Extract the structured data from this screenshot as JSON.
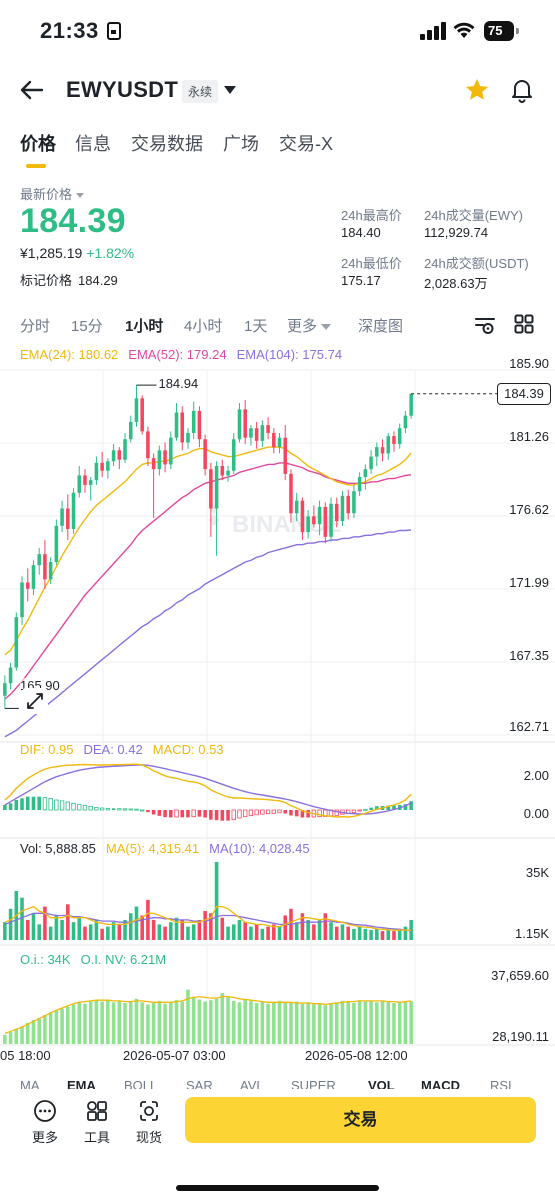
{
  "status": {
    "time": "21:33",
    "battery": "75"
  },
  "header": {
    "symbol": "EWYUSDT",
    "contract_tag": "永续"
  },
  "tabs": [
    "价格",
    "信息",
    "交易数据",
    "广场",
    "交易-X"
  ],
  "price": {
    "latest_label": "最新价格",
    "last": "184.39",
    "cny": "¥1,285.19",
    "change": "+1.82%",
    "mark_label": "标记价格",
    "mark": "184.29"
  },
  "stats": {
    "high_label": "24h最高价",
    "high": "184.40",
    "low_label": "24h最低价",
    "low": "175.17",
    "vol_label": "24h成交量(EWY)",
    "vol": "112,929.74",
    "turnover_label": "24h成交额(USDT)",
    "turnover": "2,028.63万"
  },
  "intervals": {
    "items": [
      "分时",
      "15分",
      "1小时",
      "4小时",
      "1天",
      "更多",
      "深度图"
    ],
    "active": "1小时"
  },
  "legends": {
    "ema24": "EMA(24): 180.62",
    "ema52": "EMA(52): 179.24",
    "ema104": "EMA(104): 175.74",
    "dif": "DIF: 0.95",
    "dea": "DEA: 0.42",
    "macd": "MACD: 0.53",
    "vol": "Vol: 5,888.85",
    "ma5": "MA(5): 4,315.41",
    "ma10": "MA(10): 4,028.45",
    "oi": "O.i.: 34K",
    "oinv": "O.I. NV: 6.21M"
  },
  "axes": {
    "price_ticks": [
      "185.90",
      "181.26",
      "176.62",
      "171.99",
      "167.35",
      "162.71"
    ],
    "current_price_tag": "184.39",
    "high_marker": "184.94",
    "low_marker": "165.90",
    "macd_ticks": [
      "2.00",
      "0.00"
    ],
    "vol_ticks": [
      "35K",
      "1.15K"
    ],
    "oi_ticks": [
      "37,659.60",
      "28,190.11"
    ],
    "time_labels": [
      "05 18:00",
      "2026-05-07 03:00",
      "2026-05-08 12:00"
    ]
  },
  "indicator_tabs": [
    "MA",
    "EMA",
    "BOLL",
    "SAR",
    "AVL",
    "SUPER",
    "VOL",
    "MACD",
    "RSI"
  ],
  "watermark": "BINANCE",
  "bottom": {
    "tools": [
      "更多",
      "工具",
      "现货"
    ],
    "trade_label": "交易"
  },
  "colors": {
    "up": "#2ebd85",
    "down": "#f6465d",
    "accent": "#fcd535",
    "ema24": "#f0b90b",
    "ema52": "#e0479e",
    "ema104": "#8a6fe0"
  },
  "chart_data": {
    "type": "candlestick",
    "interval": "1h",
    "ylim": [
      162.71,
      185.9
    ],
    "candles": [
      [
        165.2,
        166.5,
        164.4,
        166.0
      ],
      [
        166.0,
        167.3,
        165.6,
        167.0
      ],
      [
        167.0,
        170.5,
        166.8,
        170.2
      ],
      [
        170.2,
        172.8,
        169.7,
        172.4
      ],
      [
        172.4,
        173.3,
        171.2,
        172.0
      ],
      [
        172.0,
        173.8,
        171.6,
        173.5
      ],
      [
        173.5,
        174.6,
        172.9,
        174.2
      ],
      [
        174.2,
        175.1,
        172.0,
        172.6
      ],
      [
        172.6,
        174.0,
        172.3,
        173.7
      ],
      [
        173.7,
        176.4,
        173.5,
        176.0
      ],
      [
        176.0,
        177.6,
        175.6,
        177.1
      ],
      [
        177.1,
        178.0,
        175.1,
        175.8
      ],
      [
        175.8,
        178.4,
        175.5,
        178.1
      ],
      [
        178.1,
        179.8,
        177.8,
        179.2
      ],
      [
        179.2,
        179.6,
        178.1,
        178.6
      ],
      [
        178.6,
        179.1,
        177.6,
        178.9
      ],
      [
        178.9,
        180.4,
        178.6,
        180.0
      ],
      [
        180.0,
        180.7,
        179.1,
        179.5
      ],
      [
        179.5,
        180.3,
        179.0,
        180.1
      ],
      [
        180.1,
        181.2,
        179.8,
        180.8
      ],
      [
        180.8,
        181.0,
        179.6,
        180.2
      ],
      [
        180.2,
        181.9,
        180.0,
        181.5
      ],
      [
        181.5,
        183.0,
        181.3,
        182.6
      ],
      [
        182.6,
        184.94,
        182.3,
        184.1
      ],
      [
        184.1,
        184.3,
        181.8,
        182.0
      ],
      [
        182.0,
        182.3,
        179.8,
        180.3
      ],
      [
        180.3,
        180.6,
        176.5,
        179.6
      ],
      [
        179.6,
        181.1,
        179.2,
        180.8
      ],
      [
        180.8,
        181.3,
        179.4,
        179.9
      ],
      [
        179.9,
        182.0,
        179.6,
        181.6
      ],
      [
        181.6,
        183.8,
        181.4,
        183.2
      ],
      [
        183.2,
        183.6,
        180.8,
        181.3
      ],
      [
        181.3,
        182.2,
        180.9,
        181.9
      ],
      [
        181.9,
        183.9,
        181.5,
        183.3
      ],
      [
        183.3,
        183.6,
        181.0,
        181.5
      ],
      [
        181.5,
        181.8,
        179.2,
        179.6
      ],
      [
        179.6,
        180.0,
        175.3,
        177.1
      ],
      [
        177.1,
        180.1,
        174.1,
        179.8
      ],
      [
        179.8,
        180.2,
        178.9,
        179.2
      ],
      [
        179.2,
        179.8,
        178.8,
        179.5
      ],
      [
        179.5,
        181.9,
        179.3,
        181.5
      ],
      [
        181.5,
        183.8,
        181.3,
        183.4
      ],
      [
        183.4,
        184.0,
        181.2,
        181.6
      ],
      [
        181.6,
        182.4,
        181.1,
        182.2
      ],
      [
        182.2,
        182.6,
        180.9,
        181.4
      ],
      [
        181.4,
        182.7,
        181.0,
        182.4
      ],
      [
        182.4,
        182.9,
        181.5,
        181.9
      ],
      [
        181.9,
        182.2,
        180.6,
        181.0
      ],
      [
        181.0,
        181.9,
        180.6,
        181.6
      ],
      [
        181.6,
        182.4,
        178.9,
        179.3
      ],
      [
        179.3,
        179.6,
        176.2,
        176.8
      ],
      [
        176.8,
        178.1,
        176.3,
        177.6
      ],
      [
        177.6,
        177.8,
        175.1,
        175.6
      ],
      [
        175.6,
        177.0,
        175.2,
        176.6
      ],
      [
        176.6,
        177.3,
        175.9,
        176.1
      ],
      [
        176.1,
        177.6,
        175.4,
        177.2
      ],
      [
        177.2,
        177.5,
        174.9,
        175.3
      ],
      [
        175.3,
        177.8,
        175.0,
        177.4
      ],
      [
        177.4,
        177.8,
        175.9,
        176.3
      ],
      [
        176.3,
        178.2,
        176.0,
        177.9
      ],
      [
        177.9,
        178.3,
        176.4,
        176.8
      ],
      [
        176.8,
        178.6,
        176.5,
        178.2
      ],
      [
        178.2,
        179.4,
        177.9,
        179.1
      ],
      [
        179.1,
        179.9,
        178.3,
        179.6
      ],
      [
        179.6,
        180.8,
        179.3,
        180.4
      ],
      [
        180.4,
        181.3,
        179.8,
        181.0
      ],
      [
        181.0,
        181.5,
        180.1,
        180.6
      ],
      [
        180.6,
        181.9,
        180.2,
        181.7
      ],
      [
        181.7,
        182.0,
        180.7,
        181.2
      ],
      [
        181.2,
        182.5,
        180.9,
        182.2
      ],
      [
        182.2,
        183.3,
        181.9,
        183.0
      ],
      [
        183.0,
        184.4,
        182.8,
        184.39
      ]
    ],
    "ema24": [
      167.8,
      168.1,
      168.7,
      169.4,
      170.0,
      170.7,
      171.4,
      172.1,
      172.7,
      173.4,
      174.1,
      174.7,
      175.3,
      175.9,
      176.4,
      176.9,
      177.3,
      177.6,
      177.9,
      178.2,
      178.5,
      178.8,
      179.2,
      179.6,
      179.9,
      180.0,
      180.0,
      180.1,
      180.1,
      180.2,
      180.4,
      180.5,
      180.6,
      180.8,
      180.9,
      180.9,
      180.7,
      180.6,
      180.5,
      180.4,
      180.4,
      180.5,
      180.6,
      180.7,
      180.8,
      180.9,
      181.0,
      181.0,
      181.0,
      180.9,
      180.6,
      180.4,
      180.1,
      179.8,
      179.6,
      179.4,
      179.2,
      179.0,
      178.8,
      178.7,
      178.6,
      178.6,
      178.7,
      178.8,
      179.0,
      179.2,
      179.3,
      179.5,
      179.7,
      179.9,
      180.2,
      180.62
    ],
    "ema52": [
      165.0,
      165.3,
      165.7,
      166.1,
      166.6,
      167.1,
      167.6,
      168.1,
      168.6,
      169.1,
      169.6,
      170.1,
      170.6,
      171.1,
      171.6,
      172.0,
      172.4,
      172.8,
      173.2,
      173.6,
      174.0,
      174.4,
      174.8,
      175.3,
      175.7,
      176.0,
      176.3,
      176.6,
      176.9,
      177.2,
      177.5,
      177.8,
      178.0,
      178.3,
      178.5,
      178.7,
      178.8,
      178.9,
      179.0,
      179.1,
      179.2,
      179.4,
      179.5,
      179.6,
      179.7,
      179.8,
      179.9,
      179.9,
      180.0,
      180.0,
      179.9,
      179.8,
      179.7,
      179.5,
      179.4,
      179.3,
      179.1,
      179.0,
      178.9,
      178.8,
      178.7,
      178.7,
      178.7,
      178.7,
      178.8,
      178.8,
      178.9,
      179.0,
      179.0,
      179.1,
      179.2,
      179.24
    ],
    "ema104": [
      162.6,
      162.8,
      163.0,
      163.3,
      163.6,
      163.9,
      164.2,
      164.5,
      164.8,
      165.1,
      165.4,
      165.7,
      166.0,
      166.3,
      166.6,
      166.9,
      167.2,
      167.5,
      167.8,
      168.1,
      168.4,
      168.7,
      169.0,
      169.3,
      169.6,
      169.8,
      170.1,
      170.3,
      170.6,
      170.8,
      171.1,
      171.3,
      171.6,
      171.8,
      172.0,
      172.3,
      172.5,
      172.7,
      172.9,
      173.1,
      173.3,
      173.5,
      173.7,
      173.8,
      174.0,
      174.1,
      174.3,
      174.4,
      174.5,
      174.6,
      174.7,
      174.8,
      174.8,
      174.9,
      174.9,
      175.0,
      175.0,
      175.1,
      175.1,
      175.2,
      175.2,
      175.3,
      175.3,
      175.4,
      175.4,
      175.5,
      175.5,
      175.6,
      175.6,
      175.7,
      175.7,
      175.74
    ],
    "macd": {
      "ylim": [
        -1.2,
        3.0
      ],
      "dif": [
        0.6,
        0.9,
        1.3,
        1.6,
        1.9,
        2.1,
        2.3,
        2.45,
        2.55,
        2.6,
        2.65,
        2.68,
        2.7,
        2.72,
        2.73,
        2.72,
        2.7,
        2.7,
        2.7,
        2.72,
        2.72,
        2.73,
        2.74,
        2.75,
        2.7,
        2.55,
        2.35,
        2.2,
        2.05,
        1.95,
        1.9,
        1.8,
        1.72,
        1.68,
        1.6,
        1.45,
        1.2,
        1.05,
        0.9,
        0.78,
        0.72,
        0.72,
        0.7,
        0.68,
        0.66,
        0.65,
        0.62,
        0.58,
        0.55,
        0.45,
        0.25,
        0.12,
        -0.05,
        -0.15,
        -0.22,
        -0.28,
        -0.35,
        -0.38,
        -0.42,
        -0.4,
        -0.42,
        -0.38,
        -0.3,
        -0.2,
        -0.08,
        0.05,
        0.12,
        0.22,
        0.3,
        0.42,
        0.6,
        0.95
      ],
      "dea": [
        0.3,
        0.5,
        0.7,
        0.9,
        1.1,
        1.3,
        1.5,
        1.7,
        1.85,
        2.0,
        2.1,
        2.2,
        2.3,
        2.38,
        2.45,
        2.5,
        2.55,
        2.58,
        2.6,
        2.62,
        2.64,
        2.66,
        2.68,
        2.7,
        2.7,
        2.68,
        2.62,
        2.55,
        2.48,
        2.4,
        2.32,
        2.24,
        2.16,
        2.08,
        2.0,
        1.9,
        1.78,
        1.66,
        1.54,
        1.42,
        1.3,
        1.2,
        1.1,
        1.02,
        0.95,
        0.9,
        0.84,
        0.78,
        0.72,
        0.66,
        0.58,
        0.5,
        0.4,
        0.3,
        0.2,
        0.12,
        0.04,
        -0.03,
        -0.1,
        -0.15,
        -0.2,
        -0.22,
        -0.24,
        -0.24,
        -0.22,
        -0.18,
        -0.12,
        -0.05,
        0.03,
        0.12,
        0.25,
        0.42
      ],
      "hist": [
        0.3,
        0.4,
        0.6,
        0.7,
        0.8,
        0.8,
        0.8,
        0.75,
        0.7,
        0.6,
        0.55,
        0.48,
        0.4,
        0.34,
        0.28,
        0.22,
        0.15,
        0.12,
        0.1,
        0.1,
        0.08,
        0.07,
        0.06,
        0.05,
        0.0,
        -0.13,
        -0.27,
        -0.35,
        -0.43,
        -0.45,
        -0.42,
        -0.44,
        -0.44,
        -0.4,
        -0.4,
        -0.45,
        -0.58,
        -0.61,
        -0.64,
        -0.64,
        -0.58,
        -0.48,
        -0.4,
        -0.34,
        -0.29,
        -0.25,
        -0.22,
        -0.2,
        -0.17,
        -0.21,
        -0.33,
        -0.38,
        -0.45,
        -0.45,
        -0.42,
        -0.4,
        -0.39,
        -0.35,
        -0.32,
        -0.25,
        -0.22,
        -0.16,
        -0.06,
        0.04,
        0.14,
        0.23,
        0.24,
        0.27,
        0.27,
        0.3,
        0.35,
        0.53
      ]
    },
    "volume": {
      "ylim": [
        0,
        35000
      ],
      "values": [
        8000,
        14000,
        22000,
        19000,
        9000,
        12000,
        7000,
        15000,
        6000,
        11000,
        9000,
        16000,
        8000,
        10000,
        6000,
        7000,
        9000,
        5000,
        6000,
        8000,
        7000,
        9000,
        12000,
        15000,
        11000,
        18000,
        9000,
        7000,
        6000,
        8000,
        10000,
        9000,
        6000,
        7000,
        9000,
        13000,
        12000,
        35000,
        10000,
        6000,
        7000,
        9000,
        8000,
        6000,
        7000,
        5000,
        6000,
        7000,
        6000,
        11000,
        14000,
        8000,
        12000,
        9000,
        7000,
        9000,
        12000,
        8000,
        6000,
        7000,
        6000,
        5000,
        6000,
        5000,
        4500,
        5000,
        4000,
        4500,
        4000,
        5000,
        6000,
        9000
      ],
      "ma5": [
        8000,
        9000,
        11000,
        13000,
        14000,
        15000,
        13000,
        12000,
        10000,
        10000,
        10000,
        11000,
        10000,
        10000,
        10000,
        9000,
        8000,
        7500,
        7000,
        7000,
        7000,
        7000,
        8000,
        9000,
        10000,
        12000,
        12000,
        11000,
        10000,
        9000,
        8000,
        8000,
        8000,
        8000,
        8000,
        9000,
        10000,
        15000,
        15000,
        14000,
        12000,
        10000,
        8000,
        7500,
        7000,
        7000,
        6500,
        6000,
        6000,
        7000,
        8000,
        9000,
        10000,
        10000,
        9500,
        9000,
        9500,
        9000,
        8500,
        8000,
        7000,
        6500,
        6000,
        5800,
        5500,
        5000,
        4800,
        4600,
        4400,
        4400,
        4500,
        4315.41
      ],
      "ma10": [
        7000,
        8000,
        9000,
        10000,
        11000,
        12000,
        12000,
        12000,
        11500,
        11000,
        11000,
        11000,
        10500,
        10500,
        10000,
        9500,
        9000,
        8500,
        8500,
        8500,
        8000,
        8000,
        8000,
        8500,
        9000,
        9500,
        10000,
        10000,
        9500,
        9500,
        9000,
        9000,
        9000,
        8500,
        8500,
        8500,
        9000,
        10500,
        11000,
        11000,
        11000,
        10500,
        10000,
        9500,
        9000,
        8500,
        8000,
        7500,
        7000,
        7000,
        7000,
        7500,
        8000,
        8000,
        8000,
        8000,
        8500,
        8500,
        8000,
        8000,
        7500,
        7000,
        6800,
        6600,
        6200,
        5800,
        5500,
        5200,
        5000,
        4800,
        4500,
        4028.45
      ]
    },
    "open_interest": {
      "ylim": [
        28190.11,
        37659.6
      ],
      "values": [
        29200,
        29600,
        30000,
        30400,
        30900,
        31300,
        31600,
        32000,
        32400,
        32700,
        32900,
        33200,
        33500,
        33800,
        33600,
        33900,
        34200,
        33900,
        34100,
        33800,
        34000,
        33700,
        33900,
        34300,
        33800,
        33500,
        33700,
        34000,
        33600,
        33800,
        34100,
        33900,
        35600,
        34600,
        34200,
        33900,
        34100,
        34300,
        35100,
        34500,
        34000,
        33800,
        34200,
        34000,
        33700,
        33900,
        33600,
        33800,
        34000,
        33900,
        33700,
        33900,
        33600,
        33800,
        33500,
        33700,
        33400,
        33600,
        33800,
        34000,
        33900,
        33700,
        34100,
        33900,
        34000,
        33800,
        34000,
        33900,
        33700,
        33800,
        33900,
        34000
      ],
      "line": [
        29400,
        29700,
        30000,
        30300,
        30700,
        31100,
        31500,
        31900,
        32300,
        32700,
        33000,
        33300,
        33600,
        33800,
        33900,
        34000,
        34100,
        34100,
        34100,
        34000,
        34000,
        33900,
        33900,
        34000,
        34000,
        33900,
        33800,
        33800,
        33800,
        33800,
        33900,
        34000,
        34300,
        34500,
        34600,
        34500,
        34400,
        34400,
        34600,
        34600,
        34500,
        34300,
        34200,
        34100,
        34000,
        33900,
        33800,
        33800,
        33800,
        33800,
        33800,
        33700,
        33700,
        33700,
        33600,
        33600,
        33500,
        33600,
        33700,
        33800,
        33900,
        33900,
        34000,
        34000,
        34000,
        34000,
        34000,
        33900,
        33900,
        33800,
        33900,
        34000
      ]
    }
  }
}
